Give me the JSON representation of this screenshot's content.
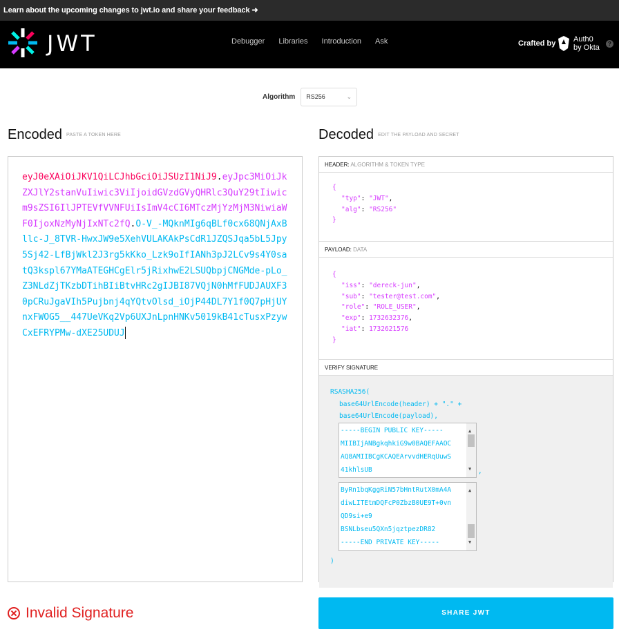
{
  "banner": {
    "text": "Learn about the upcoming changes to jwt.io and share your feedback ➜"
  },
  "header": {
    "logo_text": "JWT",
    "nav": [
      "Debugger",
      "Libraries",
      "Introduction",
      "Ask"
    ],
    "crafted_by": "Crafted by",
    "auth0_line1": "Auth0",
    "auth0_line2": "by Okta",
    "help": "?"
  },
  "algorithm": {
    "label": "Algorithm",
    "value": "RS256"
  },
  "encoded": {
    "title": "Encoded",
    "subtitle": "PASTE A TOKEN HERE",
    "token_header": "eyJ0eXAiOiJKV1QiLCJhbGciOiJSUzI1NiJ9",
    "token_payload": "eyJpc3MiOiJkZXJlY2stanVuIiwic3ViIjoidGVzdGVyQHRlc3QuY29tIiwicm9sZSI6IlJPTEVfVVNFUiIsImV4cCI6MTczMjYzMjM3NiwiaWF0IjoxNzMyNjIxNTc2fQ",
    "token_signature": "O-V_-MQknMIg6qBLf0cx68QNjAxBllc-J_8TVR-HwxJW9e5XehVULAKAkPsCdR1JZQSJqa5bL5Jpy5Sj42-LfBjWkl2J3rg5kKko_Lzk9oIfIANh3pJ2LCv9s4Y0satQ3kspl67YMaATEGHCgElr5jRixhwE2LSUQbpjCNGMde-pLo_Z3NLdZjTKzbDTihBIiBtvHRc2gIJBI87VQjN0hMfFUDJAUXF30pCRuJgaVIh5Pujbnj4qYQtvOlsd_iOjP44DL7Y1f0Q7pHjUYnxFWOG5__447UeVKq2Vp6UXJnLpnHNKv5019kB41cTusxPzywCxEFRYPMw-dXE25UDUJ"
  },
  "decoded": {
    "title": "Decoded",
    "subtitle": "EDIT THE PAYLOAD AND SECRET",
    "header_label": "HEADER:",
    "header_sub": "ALGORITHM & TOKEN TYPE",
    "header_json": {
      "typ": "\"JWT\"",
      "alg": "\"RS256\""
    },
    "payload_label": "PAYLOAD:",
    "payload_sub": "DATA",
    "payload_json": {
      "iss": "\"dereck-jun\"",
      "sub": "\"tester@test.com\"",
      "role": "\"ROLE_USER\"",
      "exp": "1732632376",
      "iat": "1732621576"
    },
    "verify_label": "VERIFY SIGNATURE",
    "verify_fn": "RSASHA256(",
    "verify_line1": "base64UrlEncode(header) + \".\" +",
    "verify_line2": "base64UrlEncode(payload),",
    "public_key_lines": [
      "-----BEGIN PUBLIC KEY-----",
      "MIIBIjANBgkqhkiG9w0BAQEFAAOC",
      "AQ8AMIIBCgKCAQEArvvdHERqUuwS",
      "41khlsUB"
    ],
    "private_key_lines": [
      "ByRn1bqKggRiN57bHntRutX0mA4A",
      "diwLITEtmDQFcP0ZbzB0UE9T+0vn",
      "QD9si+e9",
      "BSNLbseu5QXn5jqztpezDR82",
      "-----END PRIVATE KEY-----"
    ],
    "comma": ",",
    "close": ")"
  },
  "status": {
    "invalid_text": "Invalid Signature"
  },
  "share_button": "SHARE JWT",
  "colors": {
    "header_part": "#fb015b",
    "payload_part": "#d63aff",
    "signature_part": "#00b9f1",
    "invalid": "#e02020",
    "share": "#00b9f1"
  }
}
